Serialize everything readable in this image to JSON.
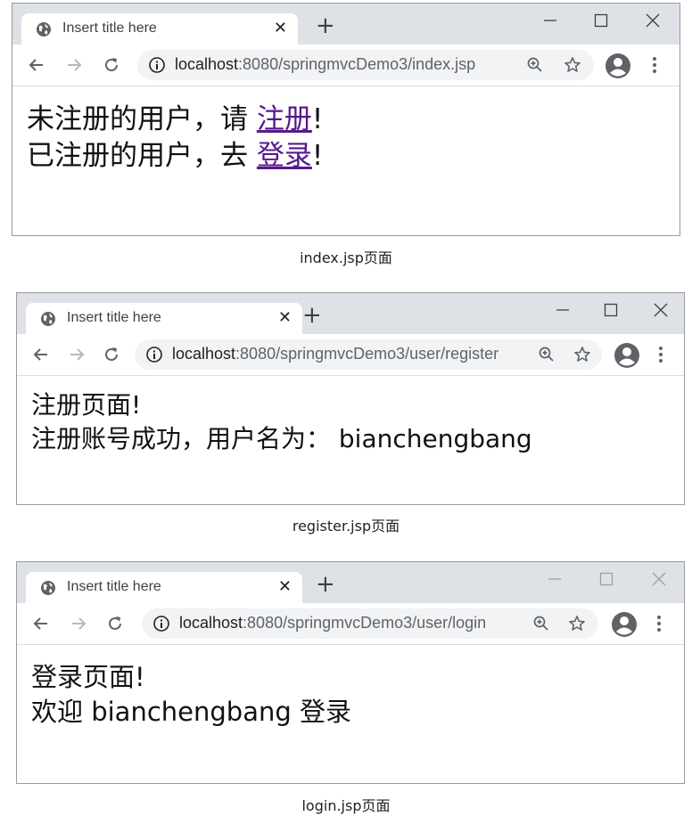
{
  "windows": [
    {
      "tab_title": "Insert title here",
      "url_host": "localhost",
      "url_rest": ":8080/springmvcDemo3/index.jsp",
      "content": {
        "line1_text": "未注册的用户，请 ",
        "line1_link": "注册",
        "line1_end": "!",
        "line2_text": "已注册的用户，去 ",
        "line2_link": "登录",
        "line2_end": "!"
      },
      "caption": "index.jsp页面"
    },
    {
      "tab_title": "Insert title here",
      "url_host": "localhost",
      "url_rest": ":8080/springmvcDemo3/user/register",
      "content": {
        "line1": "注册页面!",
        "line2": "注册账号成功，用户名为： bianchengbang"
      },
      "caption": "register.jsp页面"
    },
    {
      "tab_title": "Insert title here",
      "url_host": "localhost",
      "url_rest": ":8080/springmvcDemo3/user/login",
      "content": {
        "line1": "登录页面!",
        "line2": "欢迎 bianchengbang 登录"
      },
      "caption": "login.jsp页面"
    }
  ],
  "icons": {
    "favicon": "globe-icon",
    "tab_close": "close-icon",
    "new_tab": "plus-icon",
    "minimize": "minimize-icon",
    "maximize": "maximize-icon",
    "window_close": "close-icon",
    "back": "back-arrow-icon",
    "forward": "forward-arrow-icon",
    "reload": "reload-icon",
    "site_info": "info-icon",
    "zoom": "zoom-icon",
    "bookmark": "star-icon",
    "profile": "profile-icon",
    "menu": "kebab-menu-icon"
  },
  "glyphs": {
    "tab_close": "✕",
    "new_tab": "+"
  },
  "colors": {
    "link": "#551a8b",
    "titlebar": "#dee1e6",
    "omnibox": "#f1f3f4"
  }
}
